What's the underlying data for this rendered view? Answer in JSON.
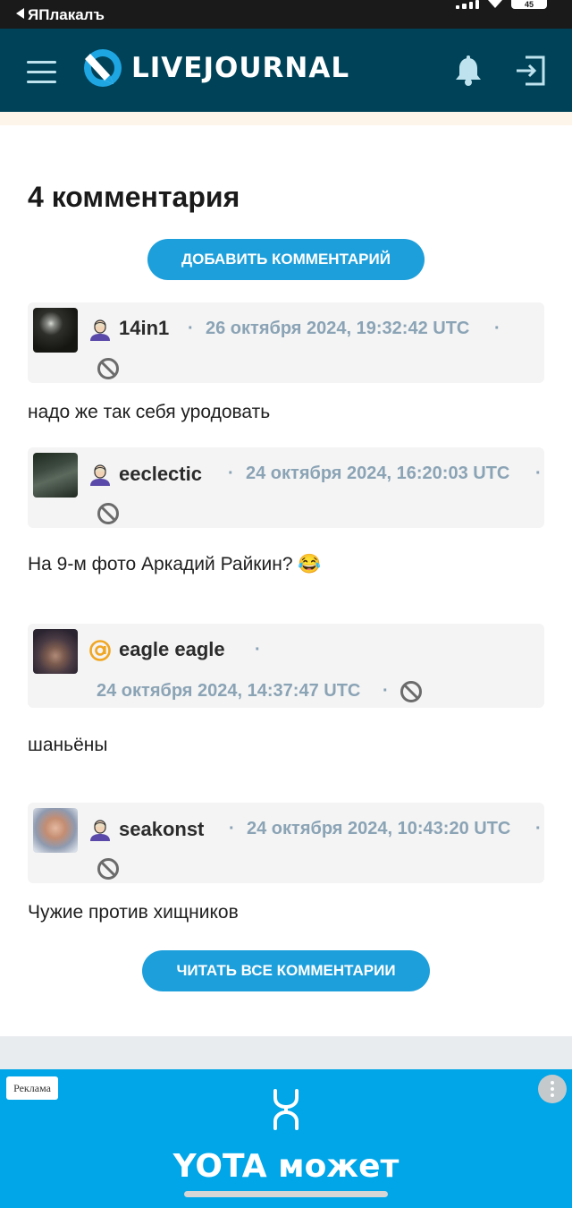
{
  "status_bar": {
    "back_app": "ЯПлакалъ",
    "battery": "45"
  },
  "header": {
    "logo_text": "LIVEJOURNAL"
  },
  "comments_section": {
    "title": "4 комментария",
    "add_button": "ДОБАВИТЬ КОММЕНТАРИЙ",
    "read_all_button": "ЧИТАТЬ ВСЕ КОММЕНТАРИИ",
    "items": [
      {
        "username": "14in1",
        "user_type": "user-icon",
        "date": "26 октября 2024, 19:32:42 UTC",
        "text": "надо же так себя уродовать"
      },
      {
        "username": "eeclectic",
        "user_type": "user-icon",
        "date": "24 октября 2024, 16:20:03 UTC",
        "text": "На 9-м фото Аркадий Райкин?"
      },
      {
        "username": "eagle eagle",
        "user_type": "at-icon",
        "date": "24 октября 2024, 14:37:47 UTC",
        "text": "шаньёны"
      },
      {
        "username": "seakonst",
        "user_type": "user-icon",
        "date": "24 октября 2024, 10:43:20 UTC",
        "text": "Чужие против хищников"
      }
    ],
    "emoji": "😂"
  },
  "ad": {
    "label": "Реклама",
    "text": "YOTA может"
  },
  "colors": {
    "header_bg": "#004359",
    "accent": "#1d9fdb",
    "date": "#8aa3b5",
    "ad_bg": "#00a6e8"
  }
}
